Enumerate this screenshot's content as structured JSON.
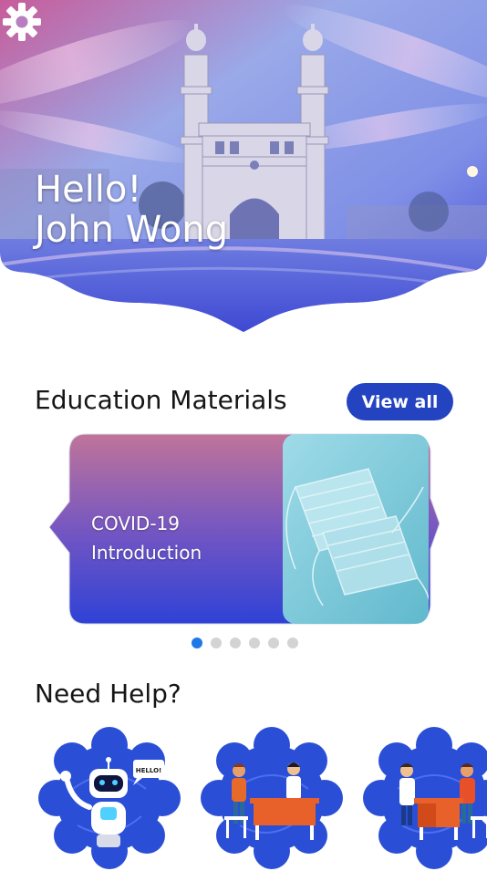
{
  "header": {
    "greeting_line1": "Hello!",
    "greeting_line2": "John Wong",
    "settings_icon": "gear-icon"
  },
  "education": {
    "title": "Education Materials",
    "view_all_label": "View all",
    "card": {
      "title_line1": "COVID-19",
      "title_line2": "Introduction"
    },
    "carousel": {
      "count": 6,
      "active_index": 0
    }
  },
  "help": {
    "title": "Need Help?",
    "bot_bubble_text": "HELLO!",
    "tiles": [
      "chatbot",
      "consultation",
      "doctor-visit"
    ]
  },
  "colors": {
    "accent": "#2343c0",
    "active_dot": "#1f78e8",
    "tile_blue": "#2a4fd6"
  }
}
